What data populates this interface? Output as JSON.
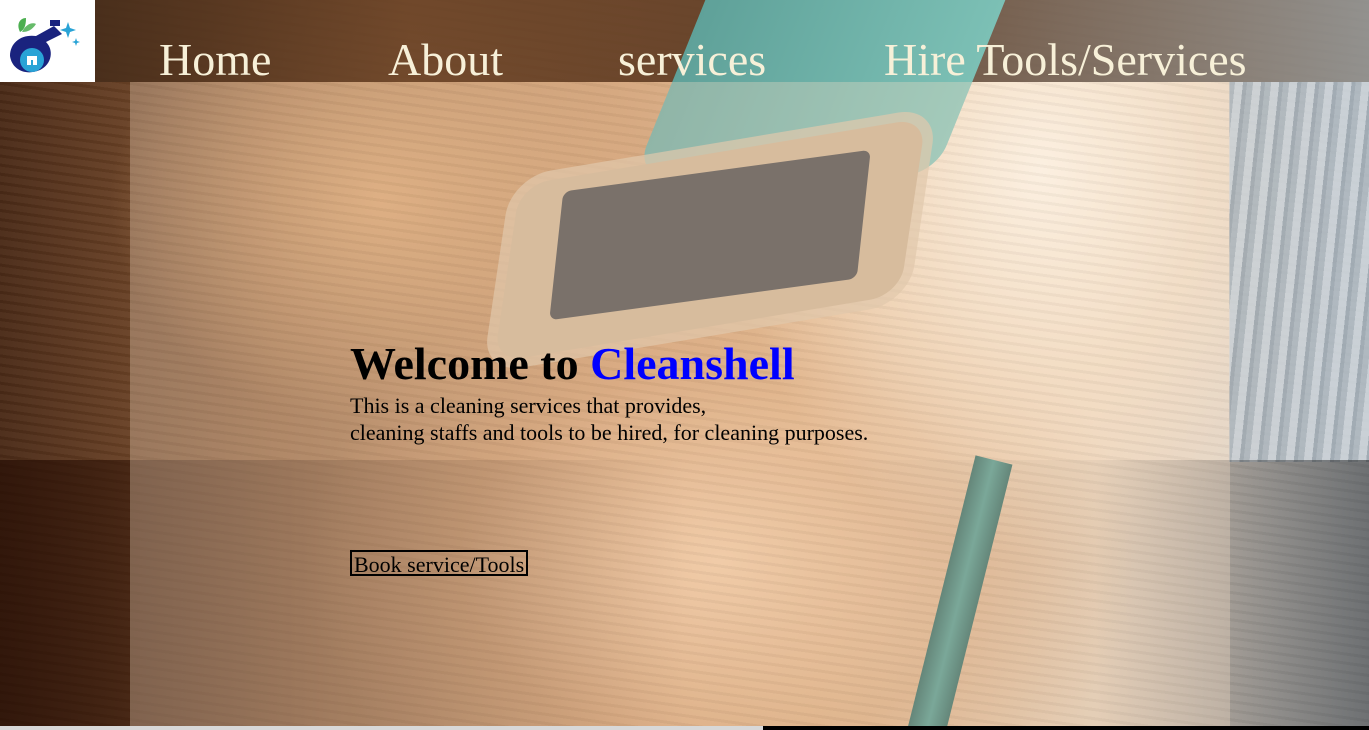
{
  "logo": {
    "icon": "cleaning-house-logo-icon"
  },
  "nav": {
    "home": "Home",
    "about": "About",
    "services": "services",
    "hire": "Hire Tools/Services"
  },
  "hero": {
    "welcome_prefix": "Welcome to ",
    "brand": "Cleanshell",
    "line1": "This is a cleaning services that provides,",
    "line2": "cleaning staffs and tools to be hired, for cleaning purposes."
  },
  "cta": {
    "book_label": "Book service/Tools"
  },
  "colors": {
    "brand": "#0000ff",
    "nav_text": "#f7f0d8",
    "panel": "rgba(250,225,200,0.32)"
  },
  "scrollbar": {
    "position_fraction": 0.56
  }
}
